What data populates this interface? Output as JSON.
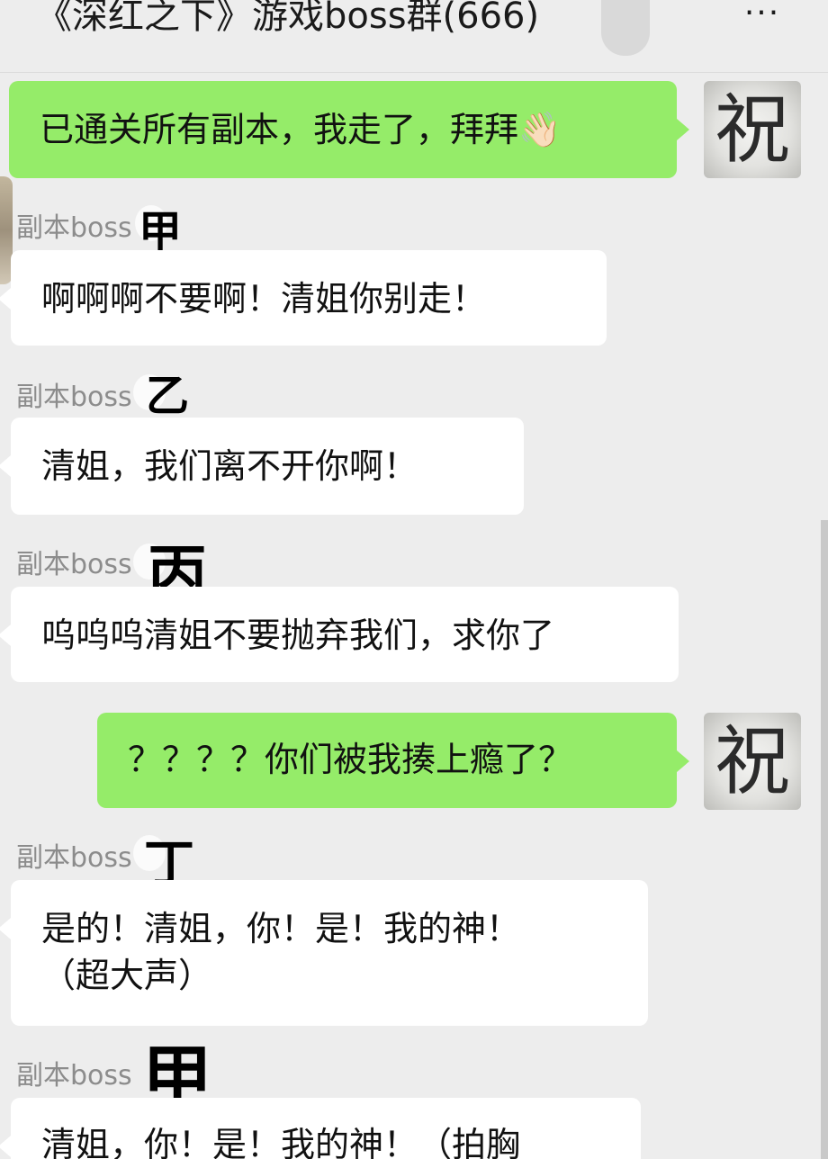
{
  "header": {
    "title": "《深红之下》游戏boss群(666)",
    "more_label": "···"
  },
  "me": {
    "avatar_char": "祝"
  },
  "messages": [
    {
      "side": "out",
      "text": "已通关所有副本，我走了，拜拜👋🏻"
    },
    {
      "side": "in",
      "sender": "副本boss",
      "sender_mark": "甲",
      "text": "啊啊啊不要啊！清姐你别走！"
    },
    {
      "side": "in",
      "sender": "副本boss",
      "sender_mark": "乙",
      "text": "清姐，我们离不开你啊！"
    },
    {
      "side": "in",
      "sender": "副本boss",
      "sender_mark": "丙",
      "text": "呜呜呜清姐不要抛弃我们，求你了"
    },
    {
      "side": "out",
      "text": "？？？？你们被我揍上瘾了？"
    },
    {
      "side": "in",
      "sender": "副本boss",
      "sender_mark": "丁",
      "text_line1": "是的！清姐，你！是！我的神！",
      "text_line2": "（超大声）"
    },
    {
      "side": "in",
      "sender": "副本boss",
      "sender_mark": "甲",
      "text": "清姐，你！是！我的神！（拍胸"
    }
  ]
}
